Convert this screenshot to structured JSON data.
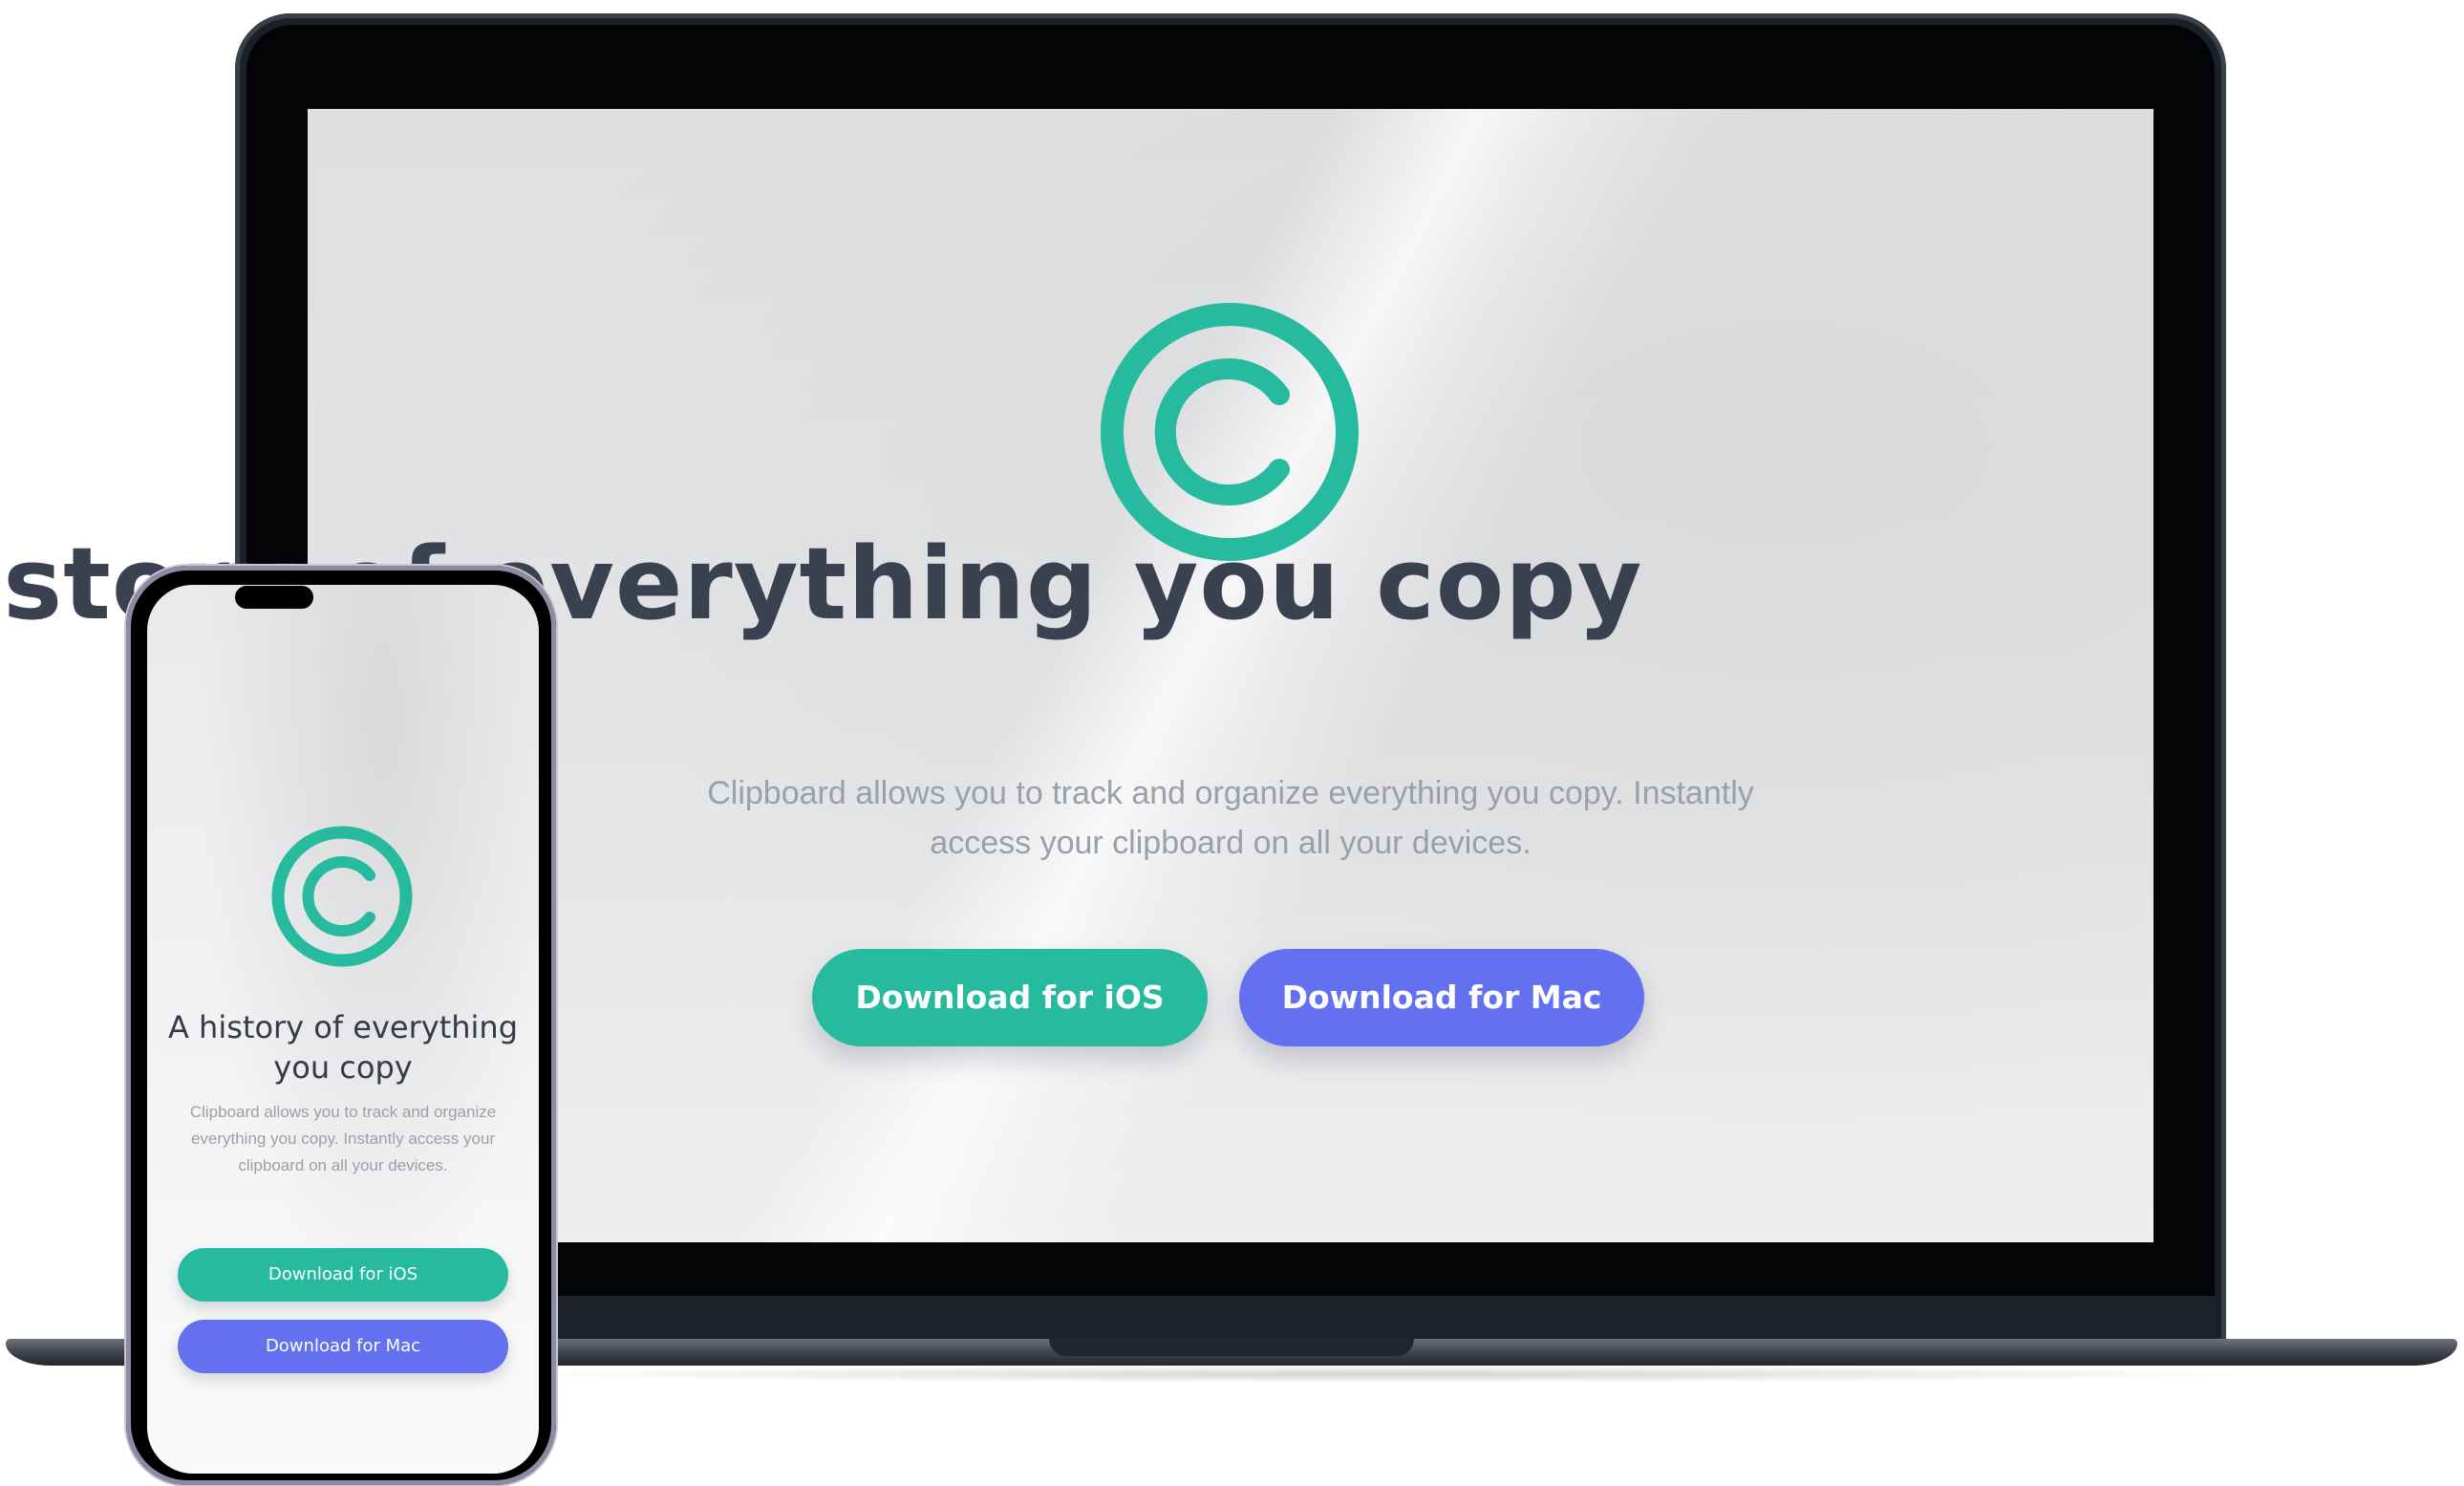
{
  "colors": {
    "accent_green": "#26ba9e",
    "accent_blue": "#6370f0",
    "title_text": "#3a4150",
    "body_text": "#9aa0a8"
  },
  "desktop": {
    "logo_icon": "copyright-c-icon",
    "title": "history of everything you copy",
    "description": "Clipboard allows you to track and organize everything you copy. Instantly access your clipboard on all your devices.",
    "buttons": {
      "ios_label": "Download for iOS",
      "mac_label": "Download for Mac"
    }
  },
  "mobile": {
    "logo_icon": "copyright-c-icon",
    "title": "A history of everything you copy",
    "description": "Clipboard allows you to track and organize everything you copy. Instantly access your clipboard on all your devices.",
    "buttons": {
      "ios_label": "Download for iOS",
      "mac_label": "Download for Mac"
    }
  }
}
